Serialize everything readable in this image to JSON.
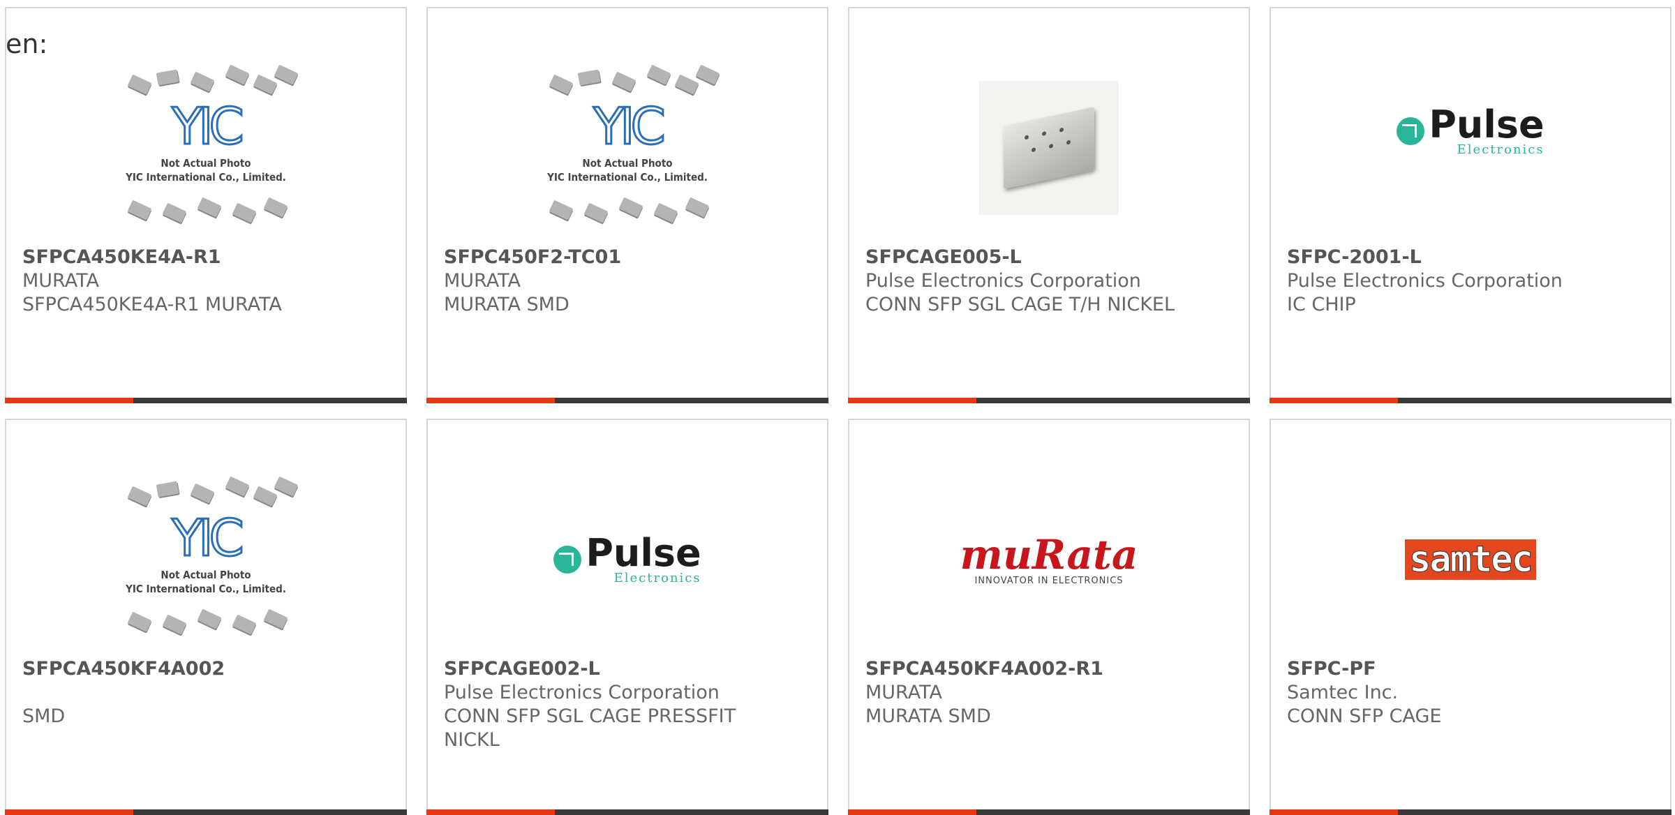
{
  "lang_label": "en:",
  "products": [
    {
      "part": "SFPCA450KE4A-R1",
      "line1": "MURATA",
      "line2": "SFPCA450KE4A-R1 MURATA",
      "line3": "",
      "image": "yic-placeholder"
    },
    {
      "part": "SFPC450F2-TC01",
      "line1": "MURATA",
      "line2": "MURATA SMD",
      "line3": "",
      "image": "yic-placeholder"
    },
    {
      "part": "SFPCAGE005-L",
      "line1": "Pulse Electronics Corporation",
      "line2": "CONN SFP SGL CAGE T/H NICKEL",
      "line3": "",
      "image": "product-photo"
    },
    {
      "part": "SFPC-2001-L",
      "line1": "Pulse Electronics Corporation",
      "line2": "IC CHIP",
      "line3": "",
      "image": "pulse-logo"
    },
    {
      "part": "SFPCA450KF4A002",
      "line1": "",
      "line2": "SMD",
      "line3": "",
      "image": "yic-placeholder"
    },
    {
      "part": "SFPCAGE002-L",
      "line1": "Pulse Electronics Corporation",
      "line2": "CONN SFP SGL CAGE PRESSFIT",
      "line3": "NICKL",
      "image": "pulse-logo"
    },
    {
      "part": "SFPCA450KF4A002-R1",
      "line1": "MURATA",
      "line2": "MURATA SMD",
      "line3": "",
      "image": "murata-logo"
    },
    {
      "part": "SFPC-PF",
      "line1": "Samtec Inc.",
      "line2": "CONN SFP CAGE",
      "line3": "",
      "image": "samtec-logo"
    }
  ],
  "yic": {
    "logo": "YIC",
    "note1": "Not Actual Photo",
    "note2": "YIC International Co., Limited."
  },
  "pulse_logo": {
    "big": "Pulse",
    "small": "Electronics"
  },
  "murata_logo": {
    "word": "muRata",
    "tag": "INNOVATOR IN ELECTRONICS"
  },
  "samtec_logo": {
    "word": "samtec"
  },
  "colors": {
    "accent": "#e53a11",
    "bar": "#3a3a3a",
    "border": "#d5d5d5"
  }
}
